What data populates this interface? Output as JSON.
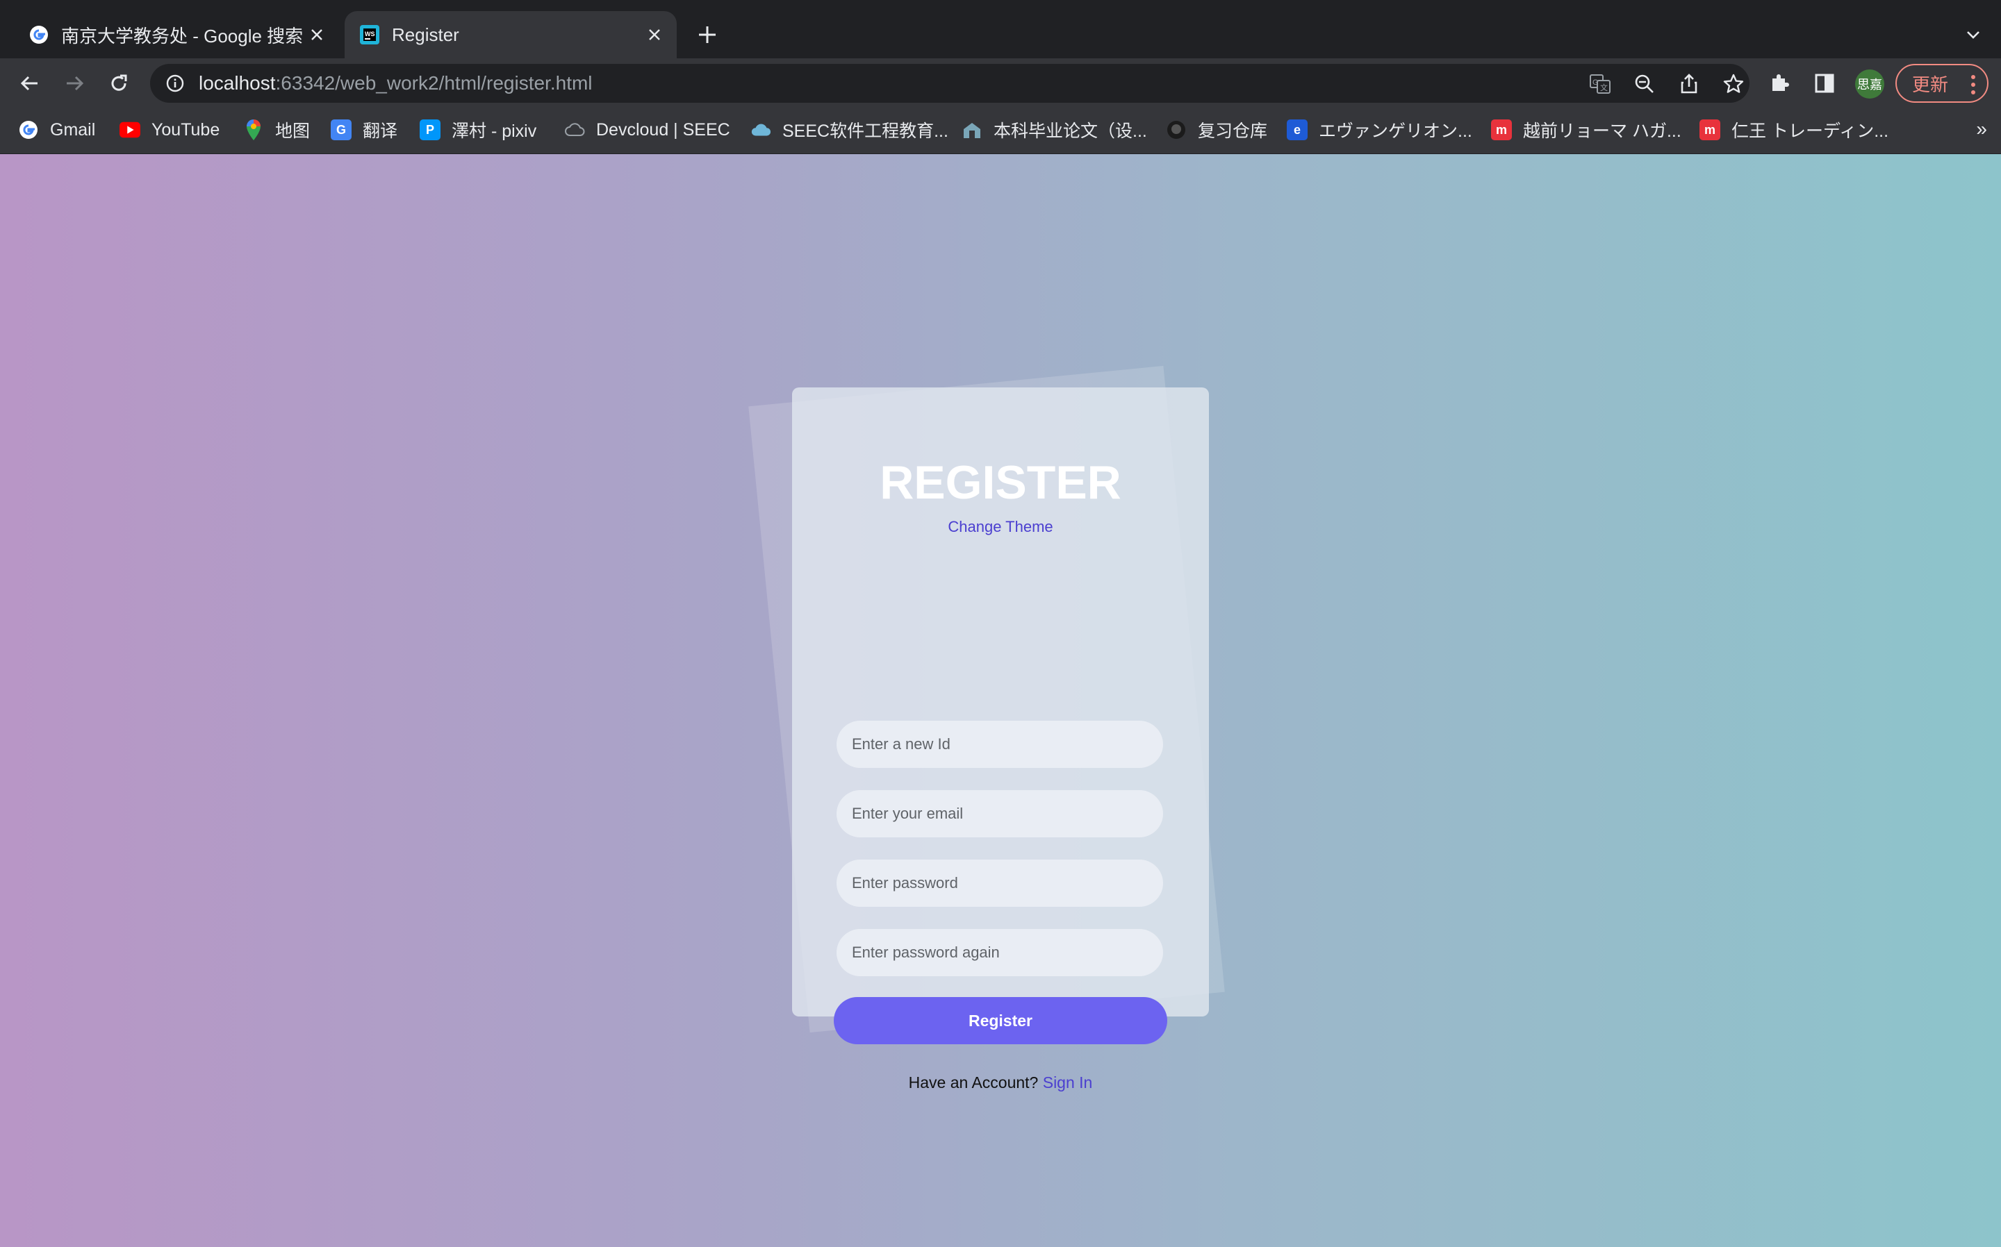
{
  "browser": {
    "tabs": [
      {
        "title": "南京大学教务处 - Google 搜索",
        "favicon": "google-g-icon",
        "active": false
      },
      {
        "title": "Register",
        "favicon": "webstorm-icon",
        "active": true
      }
    ],
    "url": {
      "host": "localhost",
      "rest": ":63342/web_work2/html/register.html"
    },
    "profile_label": "思嘉",
    "update_label": "更新",
    "bookmarks": [
      {
        "label": "Gmail",
        "icon": "gmail-icon"
      },
      {
        "label": "YouTube",
        "icon": "youtube-icon"
      },
      {
        "label": "地图",
        "icon": "maps-icon"
      },
      {
        "label": "翻译",
        "icon": "translate-icon"
      },
      {
        "label": "澤村 - pixiv",
        "icon": "pixiv-icon"
      },
      {
        "label": "Devcloud | SEEC",
        "icon": "devcloud-icon"
      },
      {
        "label": "SEEC软件工程教育...",
        "icon": "seec-cloud-icon"
      },
      {
        "label": "本科毕业论文（设...",
        "icon": "thesis-icon"
      },
      {
        "label": "复习仓库",
        "icon": "github-icon"
      },
      {
        "label": "エヴァンゲリオン...",
        "icon": "eva-icon"
      },
      {
        "label": "越前リョーマ ハガ...",
        "icon": "mercari-icon"
      },
      {
        "label": "仁王 トレーディン...",
        "icon": "mercari-icon"
      }
    ]
  },
  "page": {
    "title": "REGISTER",
    "change_theme": "Change Theme",
    "fields": {
      "id_placeholder": "Enter a new Id",
      "email_placeholder": "Enter your email",
      "password_placeholder": "Enter password",
      "password_again_placeholder": "Enter password again"
    },
    "register_button": "Register",
    "account_prompt": "Have an Account?",
    "sign_in": "Sign In"
  },
  "colors": {
    "accent": "#6c63f0",
    "link": "#4b3fd0",
    "gradient_left": "#b896c6",
    "gradient_right": "#8dc4cb"
  }
}
